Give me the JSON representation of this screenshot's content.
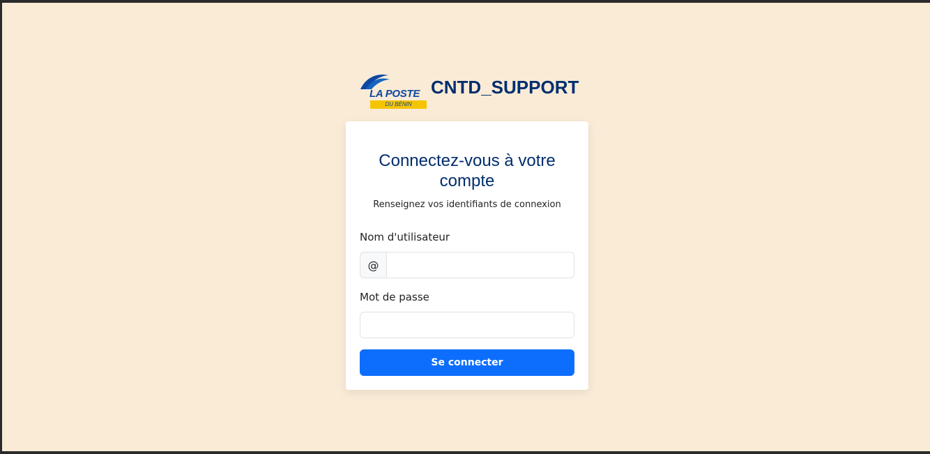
{
  "header": {
    "logo_main": "LA POSTE",
    "logo_sub": "DU BÉNIN",
    "app_title": "CNTD_SUPPORT"
  },
  "login": {
    "title": "Connectez-vous à votre compte",
    "subtitle": "Renseignez vos identifiants de connexion",
    "username_label": "Nom d'utilisateur",
    "username_prefix": "@",
    "username_value": "",
    "password_label": "Mot de passe",
    "password_value": "",
    "submit_label": "Se connecter"
  },
  "colors": {
    "background": "#faebd7",
    "brand_blue": "#002e6e",
    "button_blue": "#0d6efd",
    "logo_yellow": "#f5c400"
  }
}
